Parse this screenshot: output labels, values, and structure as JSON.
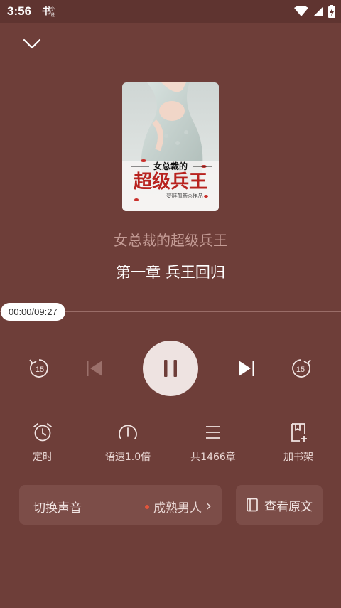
{
  "status_bar": {
    "time": "3:56",
    "app_icon_text": "书小说"
  },
  "book": {
    "cover_title_small": "女总裁的",
    "cover_title_large": "超级兵王",
    "cover_author": "梦醉孤新◎作品",
    "title": "女总裁的超级兵王",
    "chapter": "第一章  兵王回归"
  },
  "player": {
    "time_display": "00:00/09:27",
    "progress": 0.0,
    "rewind_seconds": "15",
    "forward_seconds": "15",
    "state": "playing"
  },
  "functions": {
    "timer_label": "定时",
    "speed_label": "语速1.0倍",
    "chapters_label": "共1466章",
    "bookshelf_label": "加书架"
  },
  "voice": {
    "label": "切换声音",
    "current": "成熟男人",
    "chevron": "›"
  },
  "original": {
    "label": "查看原文"
  },
  "colors": {
    "background": "#6e3e39",
    "status_bar": "#5f3430",
    "card": "#7c4d48",
    "accent_dot": "#e2553b",
    "play_button": "#eee3e1"
  }
}
